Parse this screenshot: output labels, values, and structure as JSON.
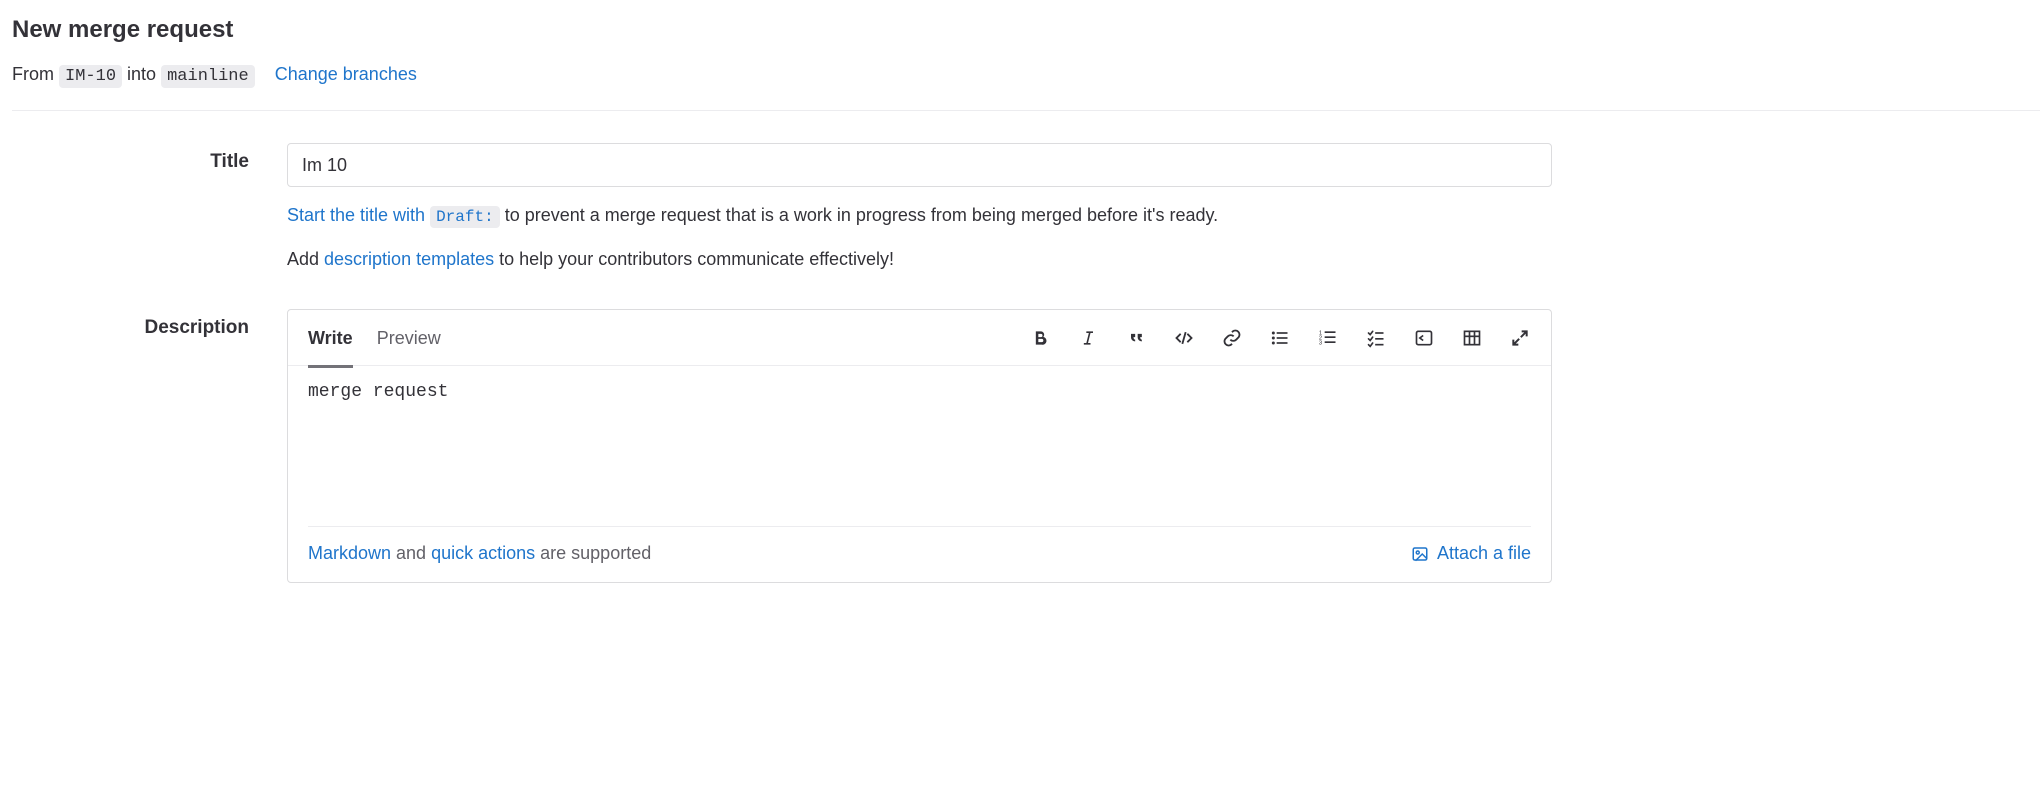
{
  "header": {
    "title": "New merge request"
  },
  "branches": {
    "from_label": "From",
    "source": "IM-10",
    "into_label": "into",
    "target": "mainline",
    "change_link": "Change branches"
  },
  "form": {
    "title_label": "Title",
    "title_value": "Im 10",
    "draft_hint_prefix_link": "Start the title with ",
    "draft_chip": "Draft:",
    "draft_hint_suffix": " to prevent a merge request that is a work in progress from being merged before it's ready.",
    "template_hint_prefix": "Add ",
    "template_hint_link": "description templates",
    "template_hint_suffix": " to help your contributors communicate effectively!",
    "description_label": "Description"
  },
  "editor": {
    "tabs": {
      "write": "Write",
      "preview": "Preview"
    },
    "content": "merge request",
    "footer": {
      "markdown_link": "Markdown",
      "and": " and ",
      "quick_actions_link": "quick actions",
      "suffix": " are supported",
      "attach": "Attach a file"
    }
  }
}
